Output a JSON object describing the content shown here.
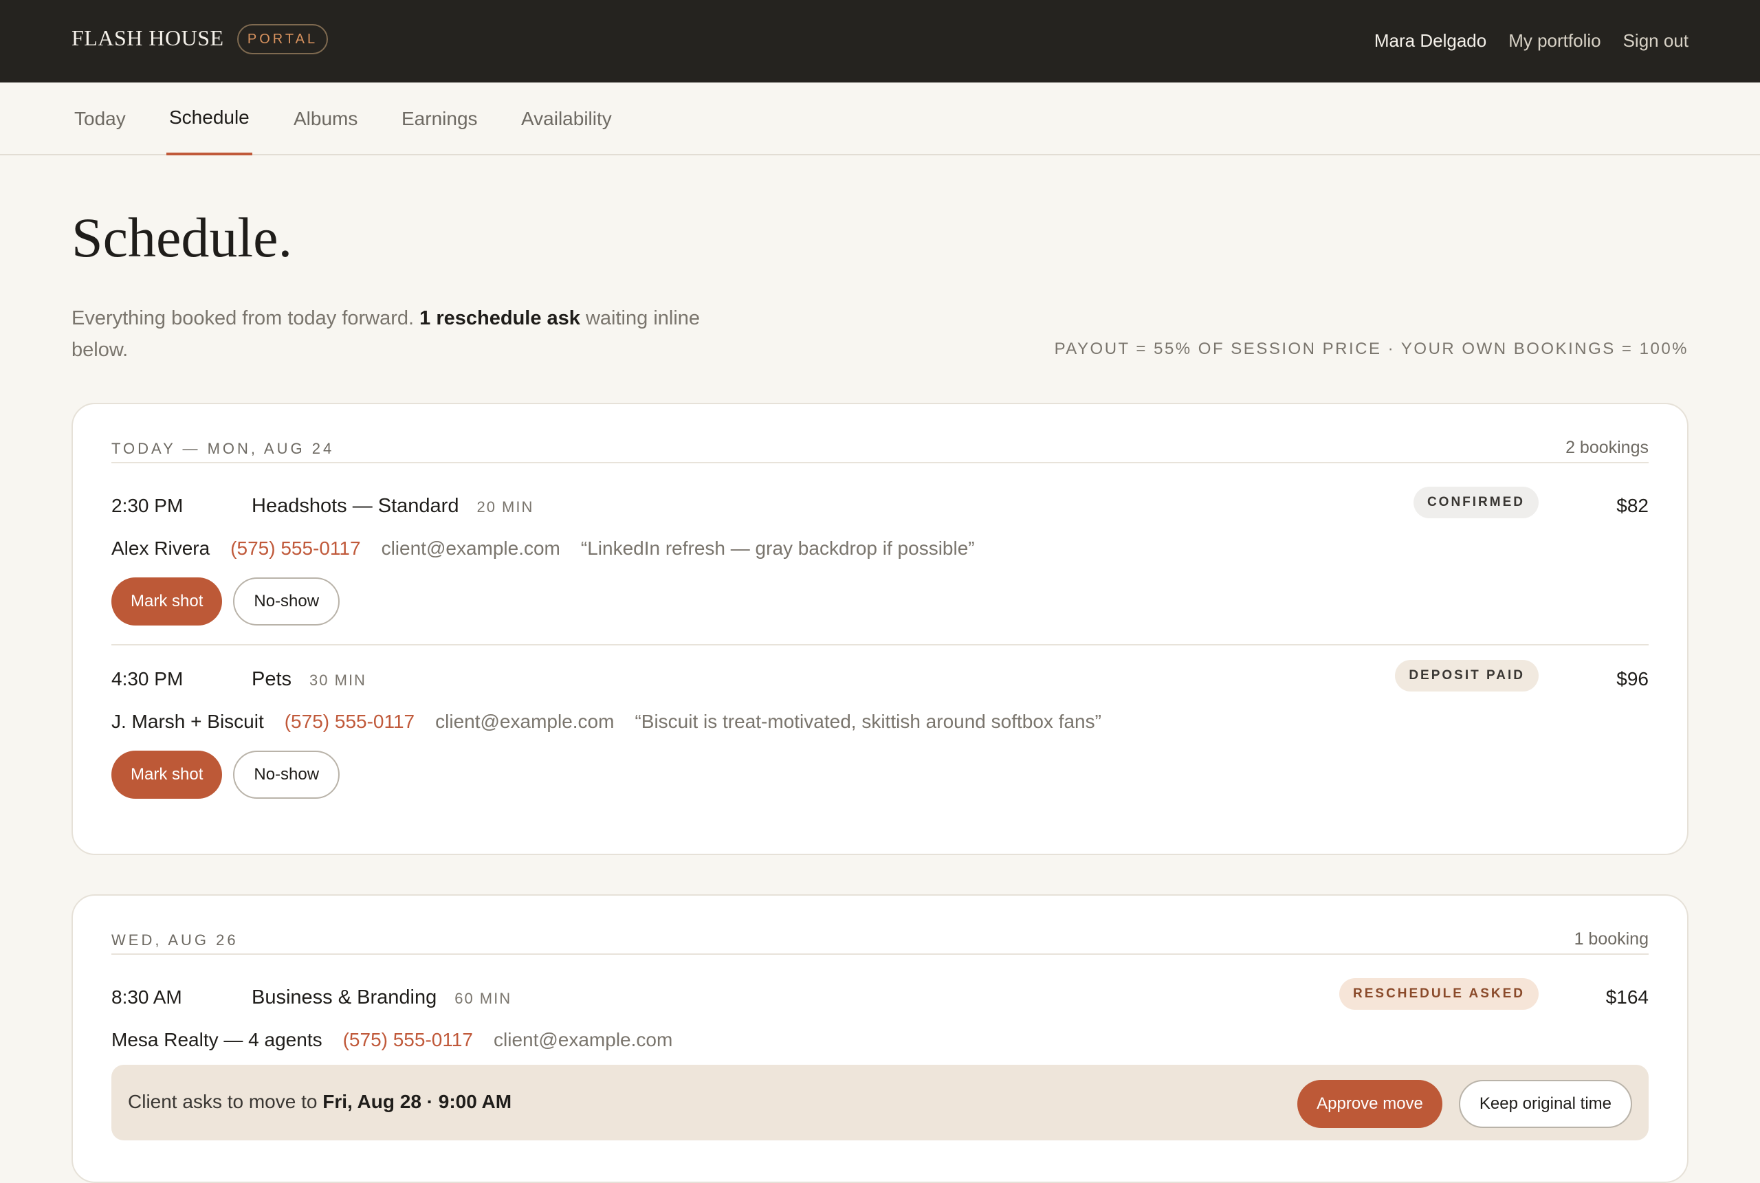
{
  "header": {
    "brand": "FLASH HOUSE",
    "badge": "PORTAL",
    "user": "Mara Delgado",
    "links": [
      "My portfolio",
      "Sign out"
    ]
  },
  "tabs": [
    {
      "label": "Today",
      "active": false
    },
    {
      "label": "Schedule",
      "active": true
    },
    {
      "label": "Albums",
      "active": false
    },
    {
      "label": "Earnings",
      "active": false
    },
    {
      "label": "Availability",
      "active": false
    }
  ],
  "page": {
    "title": "Schedule.",
    "subtitle_pre": "Everything booked from today forward.",
    "subtitle_bold": "1 reschedule ask",
    "subtitle_post": "waiting inline below.",
    "payout_note": "PAYOUT = 55% OF SESSION PRICE · YOUR OWN BOOKINGS = 100%"
  },
  "days": [
    {
      "label": "TODAY — MON, AUG 24",
      "count": "2 bookings",
      "bookings": [
        {
          "time": "2:30 PM",
          "service": "Headshots — Standard",
          "duration": "20 MIN",
          "status": "CONFIRMED",
          "price": "$82",
          "client": "Alex Rivera",
          "phone": "(575) 555-0117",
          "email": "client@example.com",
          "note": "“LinkedIn refresh — gray backdrop if possible”",
          "actions": [
            "Mark shot",
            "No-show"
          ]
        },
        {
          "time": "4:30 PM",
          "service": "Pets",
          "duration": "30 MIN",
          "status": "DEPOSIT PAID",
          "price": "$96",
          "client": "J. Marsh + Biscuit",
          "phone": "(575) 555-0117",
          "email": "client@example.com",
          "note": "“Biscuit is treat-motivated, skittish around softbox fans”",
          "actions": [
            "Mark shot",
            "No-show"
          ]
        }
      ]
    },
    {
      "label": "WED, AUG 26",
      "count": "1 booking",
      "bookings": [
        {
          "time": "8:30 AM",
          "service": "Business & Branding",
          "duration": "60 MIN",
          "status": "RESCHEDULE ASKED",
          "price": "$164",
          "client": "Mesa Realty — 4 agents",
          "phone": "(575) 555-0117",
          "email": "client@example.com",
          "reschedule": {
            "prefix": "Client asks to move to",
            "new_time": "Fri, Aug 28 · 9:00 AM",
            "approve": "Approve move",
            "keep": "Keep original time"
          }
        }
      ]
    }
  ],
  "colors": {
    "accent": "#bd5937",
    "topbar": "#25231f",
    "background": "#f8f6f1"
  }
}
